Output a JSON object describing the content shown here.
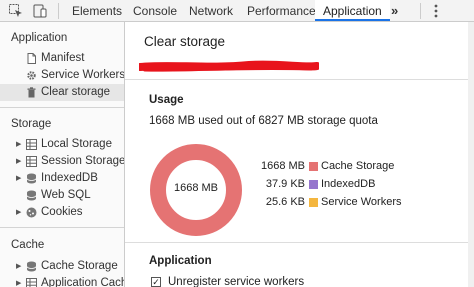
{
  "toolbar": {
    "tabs": [
      {
        "label": "Elements"
      },
      {
        "label": "Console"
      },
      {
        "label": "Network"
      },
      {
        "label": "Performance"
      },
      {
        "label": "Application",
        "active": true
      }
    ],
    "overflow": "»",
    "icons": [
      "inspect-element-icon",
      "device-toolbar-icon",
      "more-tabs-icon",
      "kebab-menu-icon"
    ]
  },
  "sidebar": {
    "application": {
      "title": "Application",
      "items": [
        {
          "label": "Manifest",
          "icon": "document-icon"
        },
        {
          "label": "Service Workers",
          "icon": "gear-icon"
        },
        {
          "label": "Clear storage",
          "icon": "trash-icon",
          "selected": true
        }
      ]
    },
    "storage": {
      "title": "Storage",
      "items": [
        {
          "label": "Local Storage",
          "icon": "grid-icon",
          "expandable": true
        },
        {
          "label": "Session Storage",
          "icon": "grid-icon",
          "expandable": true
        },
        {
          "label": "IndexedDB",
          "icon": "database-icon",
          "expandable": true
        },
        {
          "label": "Web SQL",
          "icon": "database-icon",
          "expandable": false
        },
        {
          "label": "Cookies",
          "icon": "cookie-icon",
          "expandable": true
        }
      ]
    },
    "cache": {
      "title": "Cache",
      "items": [
        {
          "label": "Cache Storage",
          "icon": "database-icon",
          "expandable": true
        },
        {
          "label": "Application Cache",
          "icon": "grid-icon",
          "expandable": true
        }
      ]
    }
  },
  "main": {
    "title": "Clear storage",
    "usage": {
      "heading": "Usage",
      "summary": "1668 MB used out of 6827 MB storage quota",
      "donut_label": "1668 MB",
      "legend": [
        {
          "value": "1668 MB",
          "label": "Cache Storage",
          "color": "#e57373"
        },
        {
          "value": "37.9 KB",
          "label": "IndexedDB",
          "color": "#9575cd"
        },
        {
          "value": "25.6 KB",
          "label": "Service Workers",
          "color": "#f4b63f"
        }
      ]
    },
    "application_section": {
      "heading": "Application",
      "checkbox_label": "Unregister service workers",
      "checked": true
    }
  },
  "colors": {
    "accent": "#1a73e8",
    "donut": "#e57373",
    "redaction": "#e8141c"
  }
}
